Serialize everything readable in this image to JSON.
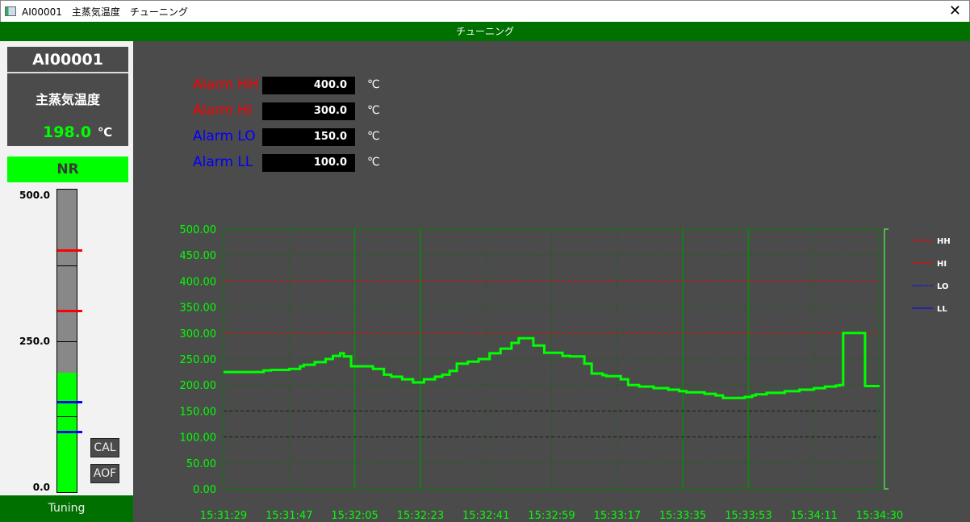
{
  "window": {
    "title": "AI00001　主蒸気温度　チューニング",
    "close_icon": "close-icon"
  },
  "header": {
    "title": "チューニング"
  },
  "faceplate": {
    "tag": "AI00001",
    "description": "主蒸気温度",
    "value": "198.0",
    "unit": "℃",
    "status": "NR",
    "scale_max": "500.0",
    "scale_mid": "250.0",
    "scale_min": "0.0",
    "level": 198.0,
    "alarm_markers": {
      "HH": 400,
      "HI": 300,
      "LO": 150,
      "LL": 100
    },
    "cal_label": "CAL",
    "aof_label": "AOF",
    "footer": "Tuning"
  },
  "alarms": [
    {
      "label": "Alarm HH",
      "value": "400.0",
      "unit": "℃",
      "color": "#ff0000"
    },
    {
      "label": "Alarm HI",
      "value": "300.0",
      "unit": "℃",
      "color": "#ff0000"
    },
    {
      "label": "Alarm LO",
      "value": "150.0",
      "unit": "℃",
      "color": "#0000ff"
    },
    {
      "label": "Alarm LL",
      "value": "100.0",
      "unit": "℃",
      "color": "#0000ff"
    }
  ],
  "chart_data": {
    "type": "line",
    "ylim": [
      0,
      500
    ],
    "yticks": [
      "0.00",
      "50.00",
      "100.00",
      "150.00",
      "200.00",
      "250.00",
      "300.00",
      "350.00",
      "400.00",
      "450.00",
      "500.00"
    ],
    "xlim": [
      "15:31:29",
      "15:34:29"
    ],
    "xticks": [
      "15:31:29",
      "15:31:47",
      "15:32:05",
      "15:32:23",
      "15:32:41",
      "15:32:59",
      "15:33:17",
      "15:33:35",
      "15:33:53",
      "15:34:11",
      "15:34:30"
    ],
    "highlight_times": [
      "15:32:05",
      "15:32:23",
      "15:33:35",
      "15:33:53"
    ],
    "grid": true,
    "legend_placement": "right",
    "limits": [
      {
        "name": "HH",
        "value": 400,
        "color": "#ff0000"
      },
      {
        "name": "HI",
        "value": 300,
        "color": "#ff0000"
      },
      {
        "name": "LO",
        "value": 150,
        "color": "#0000ff"
      },
      {
        "name": "LL",
        "value": 100,
        "color": "#0000ff"
      }
    ],
    "series_color": "#00ff00",
    "series": [
      {
        "step": true,
        "points": [
          [
            "15:31:29",
            225
          ],
          [
            "15:31:40",
            228
          ],
          [
            "15:31:42",
            229
          ],
          [
            "15:31:47",
            231
          ],
          [
            "15:31:50",
            236
          ],
          [
            "15:31:51",
            239
          ],
          [
            "15:31:54",
            244
          ],
          [
            "15:31:57",
            250
          ],
          [
            "15:31:59",
            256
          ],
          [
            "15:32:01",
            261
          ],
          [
            "15:32:02",
            255
          ],
          [
            "15:32:04",
            236
          ],
          [
            "15:32:10",
            231
          ],
          [
            "15:32:13",
            220
          ],
          [
            "15:32:15",
            216
          ],
          [
            "15:32:18",
            211
          ],
          [
            "15:32:21",
            205
          ],
          [
            "15:32:24",
            211
          ],
          [
            "15:32:27",
            216
          ],
          [
            "15:32:29",
            220
          ],
          [
            "15:32:31",
            227
          ],
          [
            "15:32:33",
            241
          ],
          [
            "15:32:36",
            245
          ],
          [
            "15:32:39",
            250
          ],
          [
            "15:32:42",
            261
          ],
          [
            "15:32:45",
            270
          ],
          [
            "15:32:48",
            281
          ],
          [
            "15:32:50",
            290
          ],
          [
            "15:32:54",
            276
          ],
          [
            "15:32:57",
            262
          ],
          [
            "15:33:02",
            256
          ],
          [
            "15:33:04",
            255
          ],
          [
            "15:33:08",
            241
          ],
          [
            "15:33:10",
            222
          ],
          [
            "15:33:13",
            219
          ],
          [
            "15:33:14",
            217
          ],
          [
            "15:33:18",
            211
          ],
          [
            "15:33:20",
            200
          ],
          [
            "15:33:23",
            197
          ],
          [
            "15:33:27",
            194
          ],
          [
            "15:33:31",
            191
          ],
          [
            "15:33:34",
            188
          ],
          [
            "15:33:36",
            186
          ],
          [
            "15:33:41",
            183
          ],
          [
            "15:33:44",
            180
          ],
          [
            "15:33:46",
            175
          ],
          [
            "15:33:52",
            177
          ],
          [
            "15:33:54",
            180
          ],
          [
            "15:33:55",
            182
          ],
          [
            "15:33:58",
            185
          ],
          [
            "15:34:03",
            188
          ],
          [
            "15:34:07",
            191
          ],
          [
            "15:34:11",
            194
          ],
          [
            "15:34:14",
            197
          ],
          [
            "15:34:17",
            199
          ],
          [
            "15:34:18",
            200
          ],
          [
            "15:34:19",
            300
          ],
          [
            "15:34:25",
            198
          ],
          [
            "15:34:29",
            198
          ]
        ]
      }
    ]
  }
}
